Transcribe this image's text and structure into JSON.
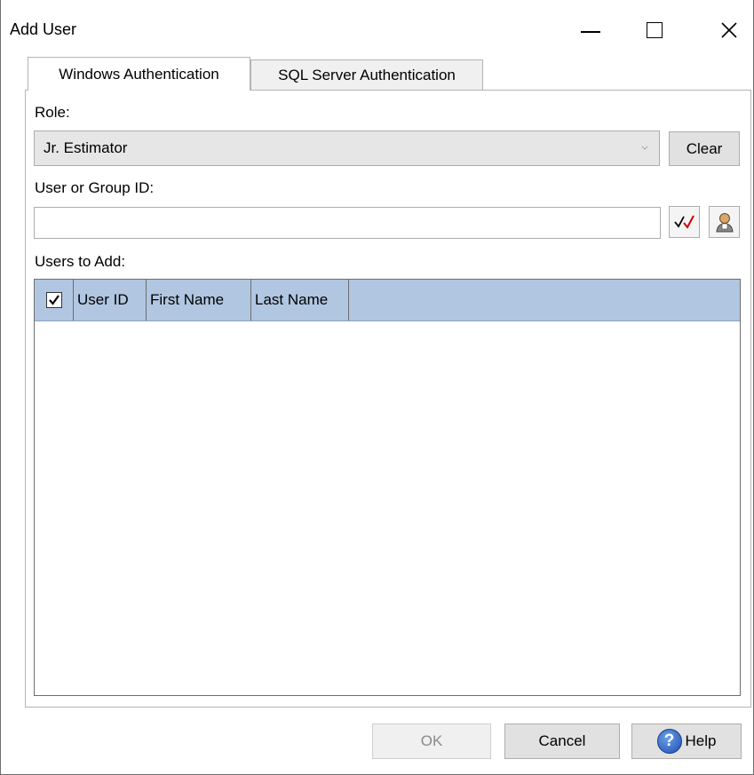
{
  "window": {
    "title": "Add User"
  },
  "tabs": [
    {
      "label": "Windows Authentication",
      "active": true
    },
    {
      "label": "SQL Server Authentication",
      "active": false
    }
  ],
  "form": {
    "role_label": "Role:",
    "role_value": "Jr. Estimator",
    "clear_label": "Clear",
    "user_group_label": "User or Group ID:",
    "user_group_value": "",
    "users_to_add_label": "Users to Add:"
  },
  "grid": {
    "columns": [
      "User ID",
      "First Name",
      "Last Name"
    ],
    "select_all_checked": true,
    "header_color": "#b1c6e1",
    "rows": []
  },
  "buttons": {
    "ok_label": "OK",
    "cancel_label": "Cancel",
    "help_label": "Help",
    "help_icon_glyph": "?"
  },
  "icons": {
    "check_names": "check-names-icon",
    "browse_user": "browse-user-icon"
  }
}
